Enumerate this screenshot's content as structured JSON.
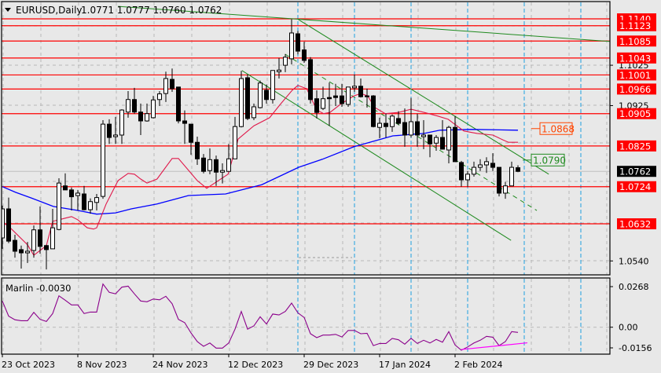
{
  "header": {
    "menu_icon": "triangle-down-icon",
    "symbol": "EURUSD,Daily",
    "ohlc": "1.0771 1.0777 1.0760 1.0762"
  },
  "colors": {
    "background": "#e8e8e8",
    "level_line": "#ff0000",
    "ma_fast": "#e0184a",
    "ma_slow": "#0000ff",
    "trendline": "#1f8a1f",
    "period_separator": "#1e9fe0",
    "oscillator": "#8b008b",
    "oscillator_trend": "#ff00ff",
    "label_1_0868": "#ff4500"
  },
  "chart_data": [
    {
      "type": "candlestick",
      "symbol": "EURUSD",
      "timeframe": "Daily",
      "ohlc_order": [
        "open",
        "high",
        "low",
        "close"
      ],
      "candles": [
        [
          1.0597,
          1.0677,
          1.057,
          1.0669
        ],
        [
          1.0669,
          1.0697,
          1.0584,
          1.0589
        ],
        [
          1.0591,
          1.0605,
          1.0548,
          1.0564
        ],
        [
          1.0568,
          1.0578,
          1.0521,
          1.056
        ],
        [
          1.056,
          1.0587,
          1.0535,
          1.0564
        ],
        [
          1.0566,
          1.0628,
          1.0548,
          1.0617
        ],
        [
          1.0617,
          1.0675,
          1.0558,
          1.0576
        ],
        [
          1.0578,
          1.058,
          1.0519,
          1.0568
        ],
        [
          1.057,
          1.0669,
          1.057,
          1.0622
        ],
        [
          1.0618,
          1.0745,
          1.0616,
          1.0733
        ],
        [
          1.0726,
          1.0757,
          1.0716,
          1.0716
        ],
        [
          1.0716,
          1.0722,
          1.0665,
          1.0699
        ],
        [
          1.0702,
          1.0716,
          1.0665,
          1.0708
        ],
        [
          1.0706,
          1.0726,
          1.0665,
          1.0667
        ],
        [
          1.0667,
          1.0695,
          1.0657,
          1.0687
        ],
        [
          1.0685,
          1.0706,
          1.0665,
          1.0697
        ],
        [
          1.07,
          1.0889,
          1.0694,
          1.0879
        ],
        [
          1.0879,
          1.0891,
          1.083,
          1.0846
        ],
        [
          1.0848,
          1.0897,
          1.083,
          1.0852
        ],
        [
          1.0852,
          1.0916,
          1.083,
          1.0914
        ],
        [
          1.0909,
          1.0961,
          1.0895,
          1.094
        ],
        [
          1.094,
          1.0969,
          1.0905,
          1.0909
        ],
        [
          1.0909,
          1.093,
          1.0852,
          1.0887
        ],
        [
          1.0887,
          1.093,
          1.0885,
          1.0905
        ],
        [
          1.0895,
          1.0949,
          1.0893,
          1.0939
        ],
        [
          1.094,
          1.0961,
          1.0924,
          1.0954
        ],
        [
          1.0955,
          1.1009,
          1.0934,
          1.0992
        ],
        [
          1.099,
          1.1017,
          1.0959,
          1.0967
        ],
        [
          1.0971,
          1.0971,
          1.0881,
          1.0887
        ],
        [
          1.0887,
          1.0913,
          1.083,
          1.0881
        ],
        [
          1.0879,
          1.0879,
          1.0803,
          1.0834
        ],
        [
          1.0834,
          1.0848,
          1.0778,
          1.0793
        ],
        [
          1.0795,
          1.0805,
          1.0757,
          1.0762
        ],
        [
          1.0764,
          1.0819,
          1.0755,
          1.0791
        ],
        [
          1.0791,
          1.0801,
          1.0726,
          1.076
        ],
        [
          1.076,
          1.0782,
          1.0732,
          1.0764
        ],
        [
          1.0762,
          1.083,
          1.0762,
          1.0793
        ],
        [
          1.0793,
          1.0897,
          1.0793,
          1.0873
        ],
        [
          1.0873,
          1.1011,
          1.0871,
          1.0992
        ],
        [
          1.0994,
          1.1002,
          1.0889,
          1.0893
        ],
        [
          1.0895,
          1.093,
          1.0889,
          1.0922
        ],
        [
          1.092,
          1.0987,
          1.0918,
          1.0981
        ],
        [
          1.0963,
          1.0977,
          1.093,
          1.094
        ],
        [
          1.094,
          1.1012,
          1.093,
          1.1012
        ],
        [
          1.1009,
          1.1043,
          1.0992,
          1.1013
        ],
        [
          1.1025,
          1.1053,
          1.1008,
          1.1045
        ],
        [
          1.1041,
          1.1139,
          1.1027,
          1.1105
        ],
        [
          1.1103,
          1.111,
          1.1052,
          1.106
        ],
        [
          1.1063,
          1.1083,
          1.1031,
          1.1037
        ],
        [
          1.1039,
          1.1045,
          1.093,
          1.094
        ],
        [
          1.0942,
          1.0963,
          1.0893,
          1.0908
        ],
        [
          1.0918,
          1.0972,
          1.0914,
          1.0942
        ],
        [
          1.0945,
          1.0982,
          1.0875,
          1.0942
        ],
        [
          1.0949,
          1.0979,
          1.0924,
          1.0945
        ],
        [
          1.0949,
          1.0979,
          1.0922,
          1.093
        ],
        [
          1.0928,
          1.0971,
          1.0922,
          1.0971
        ],
        [
          1.0969,
          1.1002,
          1.0959,
          1.0973
        ],
        [
          1.0973,
          1.0992,
          1.0945,
          1.0947
        ],
        [
          1.0949,
          1.0967,
          1.092,
          1.0947
        ],
        [
          1.0949,
          1.0951,
          1.0871,
          1.0873
        ],
        [
          1.0871,
          1.0895,
          1.0844,
          1.0881
        ],
        [
          1.0881,
          1.0905,
          1.0846,
          1.0873
        ],
        [
          1.0873,
          1.0903,
          1.086,
          1.0899
        ],
        [
          1.0893,
          1.0911,
          1.0877,
          1.0881
        ],
        [
          1.0883,
          1.0918,
          1.0823,
          1.0852
        ],
        [
          1.0852,
          1.0944,
          1.0846,
          1.0885
        ],
        [
          1.0885,
          1.0905,
          1.0823,
          1.0852
        ],
        [
          1.0848,
          1.0889,
          1.0817,
          1.0852
        ],
        [
          1.0852,
          1.0852,
          1.0797,
          1.083
        ],
        [
          1.0832,
          1.0852,
          1.0813,
          1.0846
        ],
        [
          1.0846,
          1.0889,
          1.0817,
          1.0817
        ],
        [
          1.0815,
          1.0875,
          1.0782,
          1.0871
        ],
        [
          1.0871,
          1.0899,
          1.0786,
          1.0786
        ],
        [
          1.0784,
          1.0788,
          1.0724,
          1.0741
        ],
        [
          1.0741,
          1.0763,
          1.0724,
          1.0755
        ],
        [
          1.0755,
          1.0786,
          1.0749,
          1.0772
        ],
        [
          1.0772,
          1.0792,
          1.0763,
          1.0778
        ],
        [
          1.0778,
          1.0797,
          1.0758,
          1.0786
        ],
        [
          1.0782,
          1.0807,
          1.0763,
          1.0772
        ],
        [
          1.0772,
          1.0772,
          1.07,
          1.0708
        ],
        [
          1.0708,
          1.0736,
          1.0694,
          1.0726
        ],
        [
          1.0726,
          1.0786,
          1.0726,
          1.0772
        ],
        [
          1.0771,
          1.0777,
          1.076,
          1.0762
        ]
      ],
      "ma_fast": [
        [
          0,
          1.0636
        ],
        [
          1,
          1.0626
        ],
        [
          4,
          1.058
        ],
        [
          5,
          1.0554
        ],
        [
          7,
          1.0578
        ],
        [
          8,
          1.0638
        ],
        [
          10,
          1.0646
        ],
        [
          11,
          1.065
        ],
        [
          12,
          1.0642
        ],
        [
          13.5,
          1.0622
        ],
        [
          14.5,
          1.0619
        ],
        [
          15,
          1.0622
        ],
        [
          16.5,
          1.0681
        ],
        [
          18.4,
          1.0739
        ],
        [
          20,
          1.0757
        ],
        [
          21,
          1.0755
        ],
        [
          22,
          1.0743
        ],
        [
          23,
          1.0733
        ],
        [
          24.6,
          1.0743
        ],
        [
          27,
          1.0794
        ],
        [
          28,
          1.0794
        ],
        [
          31,
          1.0739
        ],
        [
          32.5,
          1.072
        ],
        [
          35.9,
          1.0755
        ],
        [
          37.5,
          1.0842
        ],
        [
          40,
          1.0875
        ],
        [
          42.5,
          1.0895
        ],
        [
          44.2,
          1.0928
        ],
        [
          46.1,
          1.0963
        ],
        [
          47,
          1.0975
        ],
        [
          48.4,
          1.0967
        ],
        [
          50,
          1.0914
        ],
        [
          51.1,
          1.0905
        ],
        [
          52.1,
          1.0908
        ],
        [
          53.75,
          1.0928
        ],
        [
          55.9,
          1.0949
        ],
        [
          57,
          1.0955
        ],
        [
          58.1,
          1.0949
        ],
        [
          59.25,
          1.092
        ],
        [
          60.9,
          1.0905
        ],
        [
          63,
          1.0908
        ],
        [
          65,
          1.0916
        ],
        [
          67.1,
          1.0908
        ],
        [
          69.25,
          1.0899
        ],
        [
          70.9,
          1.0891
        ],
        [
          71.75,
          1.0881
        ],
        [
          73.4,
          1.0862
        ],
        [
          75.5,
          1.0856
        ],
        [
          78,
          1.0852
        ],
        [
          79.6,
          1.084
        ],
        [
          80.5,
          1.0834
        ],
        [
          82,
          1.0834
        ]
      ],
      "ma_slow": [
        [
          0,
          1.0724
        ],
        [
          2.1,
          1.071
        ],
        [
          4.6,
          1.0696
        ],
        [
          8.1,
          1.0675
        ],
        [
          12.1,
          1.0665
        ],
        [
          15,
          1.0656
        ],
        [
          18,
          1.0659
        ],
        [
          20.5,
          1.0669
        ],
        [
          24.6,
          1.0681
        ],
        [
          29.6,
          1.0702
        ],
        [
          35.5,
          1.0706
        ],
        [
          41.25,
          1.0729
        ],
        [
          47.1,
          1.0772
        ],
        [
          50.9,
          1.0792
        ],
        [
          55.9,
          1.0823
        ],
        [
          62.1,
          1.085
        ],
        [
          67.1,
          1.0856
        ],
        [
          69.6,
          1.0864
        ],
        [
          74.6,
          1.0866
        ],
        [
          82,
          1.0864
        ]
      ],
      "levels": [
        "1.1140",
        "1.1123",
        "1.1085",
        "1.1043",
        "1.1001",
        "1.0966",
        "1.0905",
        "1.0825",
        "1.0724",
        "1.0632"
      ],
      "current_price": "1.0762",
      "price_ticks": [
        "1.1025",
        "1.0925",
        "1.0540"
      ],
      "trendlines": [
        {
          "from": [
            18.4,
            1.1171
          ],
          "to": [
            98.4,
            1.1082
          ],
          "style": "solid"
        },
        {
          "from": [
            46.9,
            1.114
          ],
          "to": [
            86.9,
            1.0755
          ],
          "style": "solid"
        },
        {
          "from": [
            38.1,
            1.1012
          ],
          "to": [
            80.9,
            1.0591
          ],
          "style": "solid"
        },
        {
          "from": [
            45,
            1.1052
          ],
          "to": [
            85,
            1.0665
          ],
          "style": "dashed"
        }
      ],
      "price_labels": [
        {
          "text": "1.0868",
          "color": "#ff4500"
        },
        {
          "text": "1.0790",
          "color": "#1f8a1f"
        }
      ],
      "x_labels": [
        {
          "bar": 0,
          "label": "23 Oct 2023"
        },
        {
          "bar": 12,
          "label": "8 Nov 2023"
        },
        {
          "bar": 24,
          "label": "24 Nov 2023"
        },
        {
          "bar": 36,
          "label": "12 Dec 2023"
        },
        {
          "bar": 48,
          "label": "29 Dec 2023"
        },
        {
          "bar": 60,
          "label": "17 Jan 2024"
        },
        {
          "bar": 72,
          "label": "2 Feb 2024"
        }
      ],
      "grid": true
    },
    {
      "type": "line",
      "name": "Marlin",
      "legend": "Marlin -0.0030",
      "values": [
        0.0173,
        0.0073,
        0.0049,
        0.0043,
        0.0043,
        0.0098,
        0.0052,
        0.0038,
        0.009,
        0.0207,
        0.0178,
        0.0147,
        0.0147,
        0.009,
        0.01,
        0.01,
        0.0285,
        0.023,
        0.022,
        0.0264,
        0.0271,
        0.022,
        0.0173,
        0.0168,
        0.0186,
        0.0181,
        0.0204,
        0.0155,
        0.0052,
        0.003,
        -0.0038,
        -0.0095,
        -0.0126,
        -0.0104,
        -0.0138,
        -0.0138,
        -0.0104,
        -0.0013,
        0.0104,
        -0.0013,
        0.0009,
        0.0069,
        0.0021,
        0.0087,
        0.0081,
        0.0104,
        0.0159,
        0.0095,
        0.0064,
        -0.0043,
        -0.0069,
        -0.0052,
        -0.0052,
        -0.0047,
        -0.0064,
        -0.0021,
        -0.0021,
        -0.0043,
        -0.004,
        -0.0121,
        -0.0107,
        -0.0107,
        -0.0074,
        -0.0083,
        -0.0112,
        -0.0073,
        -0.0107,
        -0.0086,
        -0.0104,
        -0.0081,
        -0.0099,
        -0.0029,
        -0.0117,
        -0.0152,
        -0.013,
        -0.0104,
        -0.0086,
        -0.006,
        -0.0066,
        -0.0121,
        -0.0095,
        -0.0029,
        -0.0034
      ],
      "trendline": {
        "from": [
          73,
          -0.0147
        ],
        "to": [
          83.5,
          -0.0103
        ]
      },
      "y_ticks": [
        "0.0268",
        "0.00",
        "-0.0156"
      ],
      "grid": true
    }
  ]
}
